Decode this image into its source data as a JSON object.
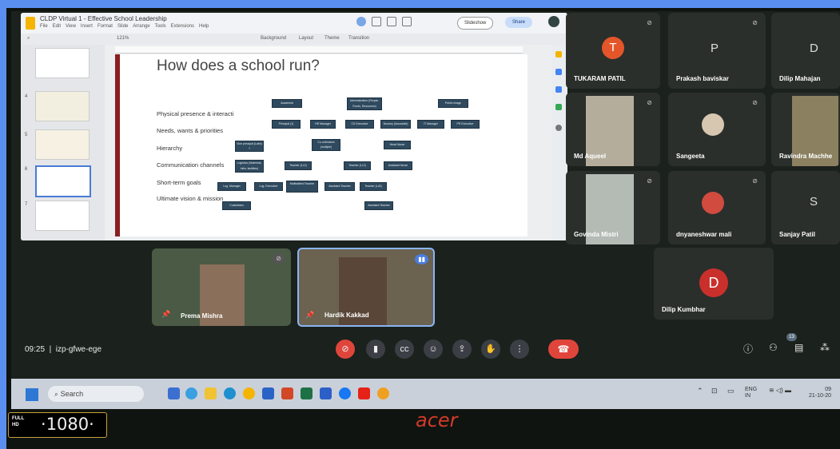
{
  "slides_app": {
    "doc_title": "CLDP Virtual 1 - Effective School Leadership",
    "menu": [
      "File",
      "Edit",
      "View",
      "Insert",
      "Format",
      "Slide",
      "Arrange",
      "Tools",
      "Extensions",
      "Help"
    ],
    "slideshow_label": "Slideshow",
    "share_label": "Share",
    "toolbar": {
      "zoom": "121%",
      "background": "Background",
      "layout": "Layout",
      "theme": "Theme",
      "transition": "Transition"
    },
    "thumb_numbers": [
      "4",
      "5",
      "6",
      "7"
    ],
    "slide": {
      "title": "How does a school run?",
      "left_items": [
        "Physical presence & interacti",
        "Needs, wants & priorities",
        "Hierarchy",
        "Communication channels",
        "Short-term goals",
        "Ultimate vision & mission"
      ],
      "boxes": [
        "Academia",
        "Administration (People, Funds, Resources)",
        "Public image",
        "Principal (1)",
        "HR Manager",
        "CS Executive",
        "Nursery (Associate)",
        "IT Manager",
        "PR Executive",
        "Vice principal (Latin) ?",
        "Co-ordinators (multiple)",
        "Head Nurse",
        "Logistics (Materials, infra, facilities)",
        "Teacher (1L2)",
        "Teacher (1L2)",
        "Assistant Nurse",
        "Log. Manager",
        "Log. Executive",
        "Multiskilled Teacher",
        "Assistant Teacher",
        "Teacher (Ld2)",
        "Custodians",
        "Assistant Teacher"
      ]
    }
  },
  "participants": [
    {
      "name": "TUKARAM PATIL",
      "initial": "T",
      "color": "#e4552a"
    },
    {
      "name": "Prakash baviskar",
      "initial": "P"
    },
    {
      "name": "Dilip Mahajan",
      "initial": "D"
    },
    {
      "name": "Md Aqueel"
    },
    {
      "name": "Sangeeta"
    },
    {
      "name": "Ravindra Machhe"
    },
    {
      "name": "Govinda Mistri"
    },
    {
      "name": "dnyaneshwar mali"
    },
    {
      "name": "Sanjay Patil",
      "initial": "S"
    },
    {
      "name": "Prema Mishra"
    },
    {
      "name": "Hardik Kakkad"
    },
    {
      "name": "Dilip Kumbhar",
      "initial": "D",
      "color": "#c9302c"
    }
  ],
  "meeting": {
    "time": "09:25",
    "code": "izp-gfwe-ege",
    "participant_count": "13"
  },
  "taskbar": {
    "search": "Search",
    "lang_top": "ENG",
    "lang_bottom": "IN",
    "clock_time": "09",
    "clock_date": "21-10-20"
  },
  "branding": {
    "full": "FULL",
    "hd": "HD",
    "resolution": "1080",
    "laptop": "acer"
  }
}
